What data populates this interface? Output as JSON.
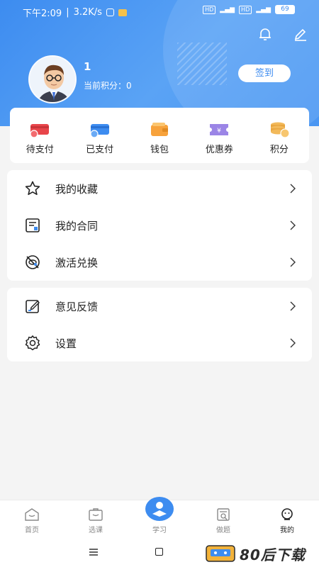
{
  "status_bar": {
    "time": "下午2:09",
    "speed": "3.2K/s",
    "battery": "69"
  },
  "profile": {
    "name": "1",
    "points": "当前积分：0",
    "signin_label": "签到"
  },
  "quick_actions": [
    {
      "label": "待支付",
      "icon": "pending-payment-icon"
    },
    {
      "label": "已支付",
      "icon": "paid-icon"
    },
    {
      "label": "钱包",
      "icon": "wallet-icon"
    },
    {
      "label": "优惠券",
      "icon": "coupon-icon"
    },
    {
      "label": "积分",
      "icon": "points-icon"
    }
  ],
  "menu_group1": [
    {
      "label": "我的收藏",
      "icon": "star-icon"
    },
    {
      "label": "我的合同",
      "icon": "contract-icon"
    },
    {
      "label": "激活兑换",
      "icon": "activate-icon"
    }
  ],
  "menu_group2": [
    {
      "label": "意见反馈",
      "icon": "feedback-icon"
    },
    {
      "label": "设置",
      "icon": "gear-icon"
    }
  ],
  "tabs": [
    {
      "label": "首页",
      "icon": "home-icon"
    },
    {
      "label": "选课",
      "icon": "course-icon"
    },
    {
      "label": "学习",
      "icon": "study-icon"
    },
    {
      "label": "做题",
      "icon": "exercise-icon"
    },
    {
      "label": "我的",
      "icon": "profile-icon"
    }
  ],
  "colors": {
    "primary": "#3d8cf0",
    "red": "#e8454a",
    "orange": "#f7a23b",
    "purple": "#9b85e6"
  },
  "watermark": "80后下载"
}
